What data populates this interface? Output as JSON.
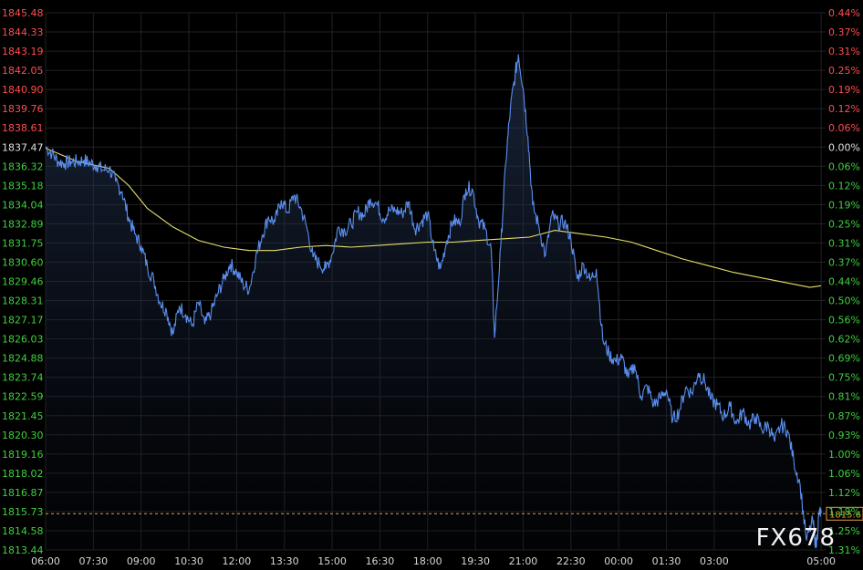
{
  "watermark": "FX678",
  "chart_data": {
    "type": "line",
    "last_price_label": "1815.6",
    "reference_price": 1837.47,
    "y_left_ticks": [
      "1845.48",
      "1844.33",
      "1843.19",
      "1842.05",
      "1840.90",
      "1839.76",
      "1838.61",
      "1837.47",
      "1836.32",
      "1835.18",
      "1834.04",
      "1832.89",
      "1831.75",
      "1830.60",
      "1829.46",
      "1828.31",
      "1827.17",
      "1826.03",
      "1824.88",
      "1823.74",
      "1822.59",
      "1821.45",
      "1820.30",
      "1819.16",
      "1818.02",
      "1816.87",
      "1815.73",
      "1814.58",
      "1813.44"
    ],
    "y_right_ticks": [
      "0.44%",
      "0.37%",
      "0.31%",
      "0.25%",
      "0.19%",
      "0.12%",
      "0.06%",
      "0.00%",
      "0.06%",
      "0.12%",
      "0.19%",
      "0.25%",
      "0.31%",
      "0.37%",
      "0.44%",
      "0.50%",
      "0.56%",
      "0.62%",
      "0.69%",
      "0.75%",
      "0.81%",
      "0.87%",
      "0.93%",
      "1.00%",
      "1.06%",
      "1.12%",
      "1.18%",
      "1.25%",
      "1.31%"
    ],
    "x_ticks": [
      "06:00",
      "07:30",
      "09:00",
      "10:30",
      "12:00",
      "13:30",
      "15:00",
      "16:30",
      "18:00",
      "19:30",
      "21:00",
      "22:30",
      "00:00",
      "01:30",
      "03:00",
      "05:00"
    ],
    "ylim": [
      1813.44,
      1845.48
    ],
    "colors": {
      "price_line": "#5b8ff0",
      "average_line": "#e8e06a",
      "up_label": "#ff4d4d",
      "down_label": "#3ed13e",
      "neutral_label": "#e0e0e0",
      "last_price_line": "#e0a040",
      "grid": "#222222"
    },
    "series": [
      {
        "values": [
          [
            0,
            1837.5
          ],
          [
            0.2,
            1837.1
          ],
          [
            0.4,
            1836.6
          ],
          [
            0.6,
            1836.5
          ],
          [
            0.8,
            1836.6
          ],
          [
            1.0,
            1836.6
          ],
          [
            1.2,
            1836.7
          ],
          [
            1.4,
            1836.5
          ],
          [
            1.6,
            1836.4
          ],
          [
            1.8,
            1836.1
          ],
          [
            2.0,
            1836.2
          ],
          [
            2.2,
            1835.4
          ],
          [
            2.4,
            1834.8
          ],
          [
            2.6,
            1833.3
          ],
          [
            2.8,
            1832.3
          ],
          [
            3.0,
            1831.6
          ],
          [
            3.2,
            1830.3
          ],
          [
            3.4,
            1829.5
          ],
          [
            3.6,
            1828.2
          ],
          [
            3.8,
            1827.7
          ],
          [
            4.0,
            1826.3
          ],
          [
            4.2,
            1828.0
          ],
          [
            4.4,
            1827.5
          ],
          [
            4.6,
            1826.8
          ],
          [
            4.8,
            1828.2
          ],
          [
            5.0,
            1826.9
          ],
          [
            5.2,
            1827.6
          ],
          [
            5.4,
            1828.7
          ],
          [
            5.6,
            1829.6
          ],
          [
            5.8,
            1830.5
          ],
          [
            6.0,
            1830.0
          ],
          [
            6.2,
            1829.3
          ],
          [
            6.4,
            1829.0
          ],
          [
            6.6,
            1830.9
          ],
          [
            6.8,
            1832.2
          ],
          [
            7.0,
            1833.3
          ],
          [
            7.2,
            1833.0
          ],
          [
            7.4,
            1834.3
          ],
          [
            7.6,
            1833.6
          ],
          [
            7.8,
            1834.6
          ],
          [
            8.0,
            1833.9
          ],
          [
            8.2,
            1832.7
          ],
          [
            8.4,
            1830.9
          ],
          [
            8.6,
            1830.5
          ],
          [
            8.8,
            1830.2
          ],
          [
            9.0,
            1831.1
          ],
          [
            9.2,
            1832.7
          ],
          [
            9.4,
            1832.5
          ],
          [
            9.6,
            1832.9
          ],
          [
            9.8,
            1833.6
          ],
          [
            10.0,
            1833.4
          ],
          [
            10.2,
            1834.4
          ],
          [
            10.4,
            1834.1
          ],
          [
            10.6,
            1833.2
          ],
          [
            10.8,
            1833.7
          ],
          [
            11.0,
            1833.7
          ],
          [
            11.2,
            1833.5
          ],
          [
            11.4,
            1834.2
          ],
          [
            11.6,
            1832.6
          ],
          [
            11.8,
            1833.0
          ],
          [
            12.0,
            1833.5
          ],
          [
            12.2,
            1831.3
          ],
          [
            12.4,
            1830.2
          ],
          [
            12.6,
            1831.9
          ],
          [
            12.8,
            1833.1
          ],
          [
            13.0,
            1832.9
          ],
          [
            13.2,
            1835.0
          ],
          [
            13.4,
            1835.0
          ],
          [
            13.6,
            1833.1
          ],
          [
            13.8,
            1832.6
          ],
          [
            14.0,
            1831.3
          ],
          [
            14.1,
            1826.1
          ],
          [
            14.3,
            1831.6
          ],
          [
            14.45,
            1836.5
          ],
          [
            14.6,
            1839.8
          ],
          [
            14.75,
            1841.8
          ],
          [
            14.85,
            1843.0
          ],
          [
            15.0,
            1841.0
          ],
          [
            15.15,
            1838.1
          ],
          [
            15.3,
            1834.0
          ],
          [
            15.5,
            1832.7
          ],
          [
            15.7,
            1831.0
          ],
          [
            15.9,
            1833.4
          ],
          [
            16.1,
            1832.9
          ],
          [
            16.3,
            1833.0
          ],
          [
            16.5,
            1832.0
          ],
          [
            16.7,
            1829.6
          ],
          [
            16.9,
            1830.5
          ],
          [
            17.1,
            1829.5
          ],
          [
            17.3,
            1830.2
          ],
          [
            17.5,
            1826.0
          ],
          [
            17.7,
            1825.1
          ],
          [
            17.9,
            1824.7
          ],
          [
            18.1,
            1824.9
          ],
          [
            18.3,
            1823.7
          ],
          [
            18.5,
            1824.5
          ],
          [
            18.7,
            1822.6
          ],
          [
            18.9,
            1823.2
          ],
          [
            19.1,
            1822.1
          ],
          [
            19.3,
            1822.5
          ],
          [
            19.5,
            1823.0
          ],
          [
            19.7,
            1821.2
          ],
          [
            19.9,
            1821.7
          ],
          [
            20.1,
            1823.1
          ],
          [
            20.3,
            1822.8
          ],
          [
            20.5,
            1824.0
          ],
          [
            20.7,
            1823.5
          ],
          [
            20.9,
            1822.4
          ],
          [
            21.1,
            1822.1
          ],
          [
            21.3,
            1821.4
          ],
          [
            21.5,
            1822.0
          ],
          [
            21.7,
            1821.0
          ],
          [
            21.9,
            1821.7
          ],
          [
            22.1,
            1820.9
          ],
          [
            22.3,
            1821.4
          ],
          [
            22.5,
            1820.6
          ],
          [
            22.7,
            1820.9
          ],
          [
            22.9,
            1819.9
          ],
          [
            23.1,
            1820.9
          ],
          [
            23.3,
            1820.6
          ],
          [
            23.5,
            1818.8
          ],
          [
            23.7,
            1817.3
          ],
          [
            23.9,
            1814.0
          ],
          [
            24.1,
            1815.2
          ],
          [
            24.2,
            1813.6
          ],
          [
            24.3,
            1815.7
          ],
          [
            24.36,
            1815.6
          ]
        ]
      },
      {
        "values": [
          [
            0,
            1837.4
          ],
          [
            1.0,
            1836.6
          ],
          [
            2.0,
            1836.2
          ],
          [
            2.6,
            1835.2
          ],
          [
            3.2,
            1833.8
          ],
          [
            4.0,
            1832.7
          ],
          [
            4.8,
            1831.9
          ],
          [
            5.6,
            1831.5
          ],
          [
            6.4,
            1831.3
          ],
          [
            7.2,
            1831.3
          ],
          [
            8.0,
            1831.5
          ],
          [
            8.8,
            1831.6
          ],
          [
            9.6,
            1831.5
          ],
          [
            10.4,
            1831.6
          ],
          [
            11.2,
            1831.7
          ],
          [
            12.0,
            1831.8
          ],
          [
            12.8,
            1831.8
          ],
          [
            13.6,
            1831.9
          ],
          [
            14.4,
            1832.0
          ],
          [
            15.2,
            1832.1
          ],
          [
            16.0,
            1832.5
          ],
          [
            16.8,
            1832.3
          ],
          [
            17.6,
            1832.1
          ],
          [
            18.4,
            1831.8
          ],
          [
            19.2,
            1831.3
          ],
          [
            20.0,
            1830.8
          ],
          [
            20.8,
            1830.4
          ],
          [
            21.6,
            1830.0
          ],
          [
            22.4,
            1829.7
          ],
          [
            23.2,
            1829.4
          ],
          [
            24.0,
            1829.1
          ],
          [
            24.36,
            1829.2
          ]
        ]
      }
    ]
  }
}
